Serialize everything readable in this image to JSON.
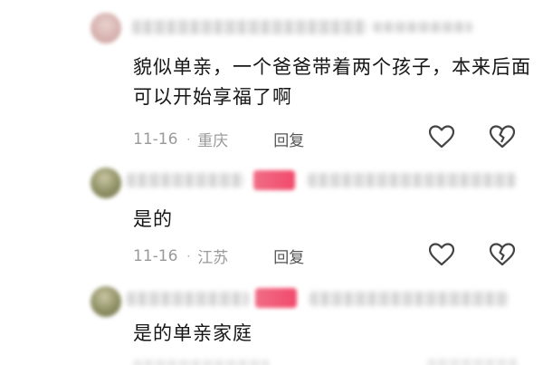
{
  "comments": [
    {
      "text": "貌似单亲，一个爸爸带着两个孩子，本来后面可以开始享福了啊",
      "date": "11-16",
      "separator": "·",
      "location": "重庆",
      "reply_label": "回复",
      "like_icon": "heart-outline-icon",
      "dislike_icon": "broken-heart-icon"
    },
    {
      "text": "是的",
      "date": "11-16",
      "separator": "·",
      "location": "江苏",
      "reply_label": "回复",
      "like_icon": "heart-outline-icon",
      "dislike_icon": "broken-heart-icon"
    },
    {
      "text": "是的单亲家庭"
    }
  ],
  "colors": {
    "meta_text": "#9a9a9a",
    "reply_text": "#555555",
    "badge_pink": "#f24a6b",
    "icon_stroke": "#444444"
  }
}
